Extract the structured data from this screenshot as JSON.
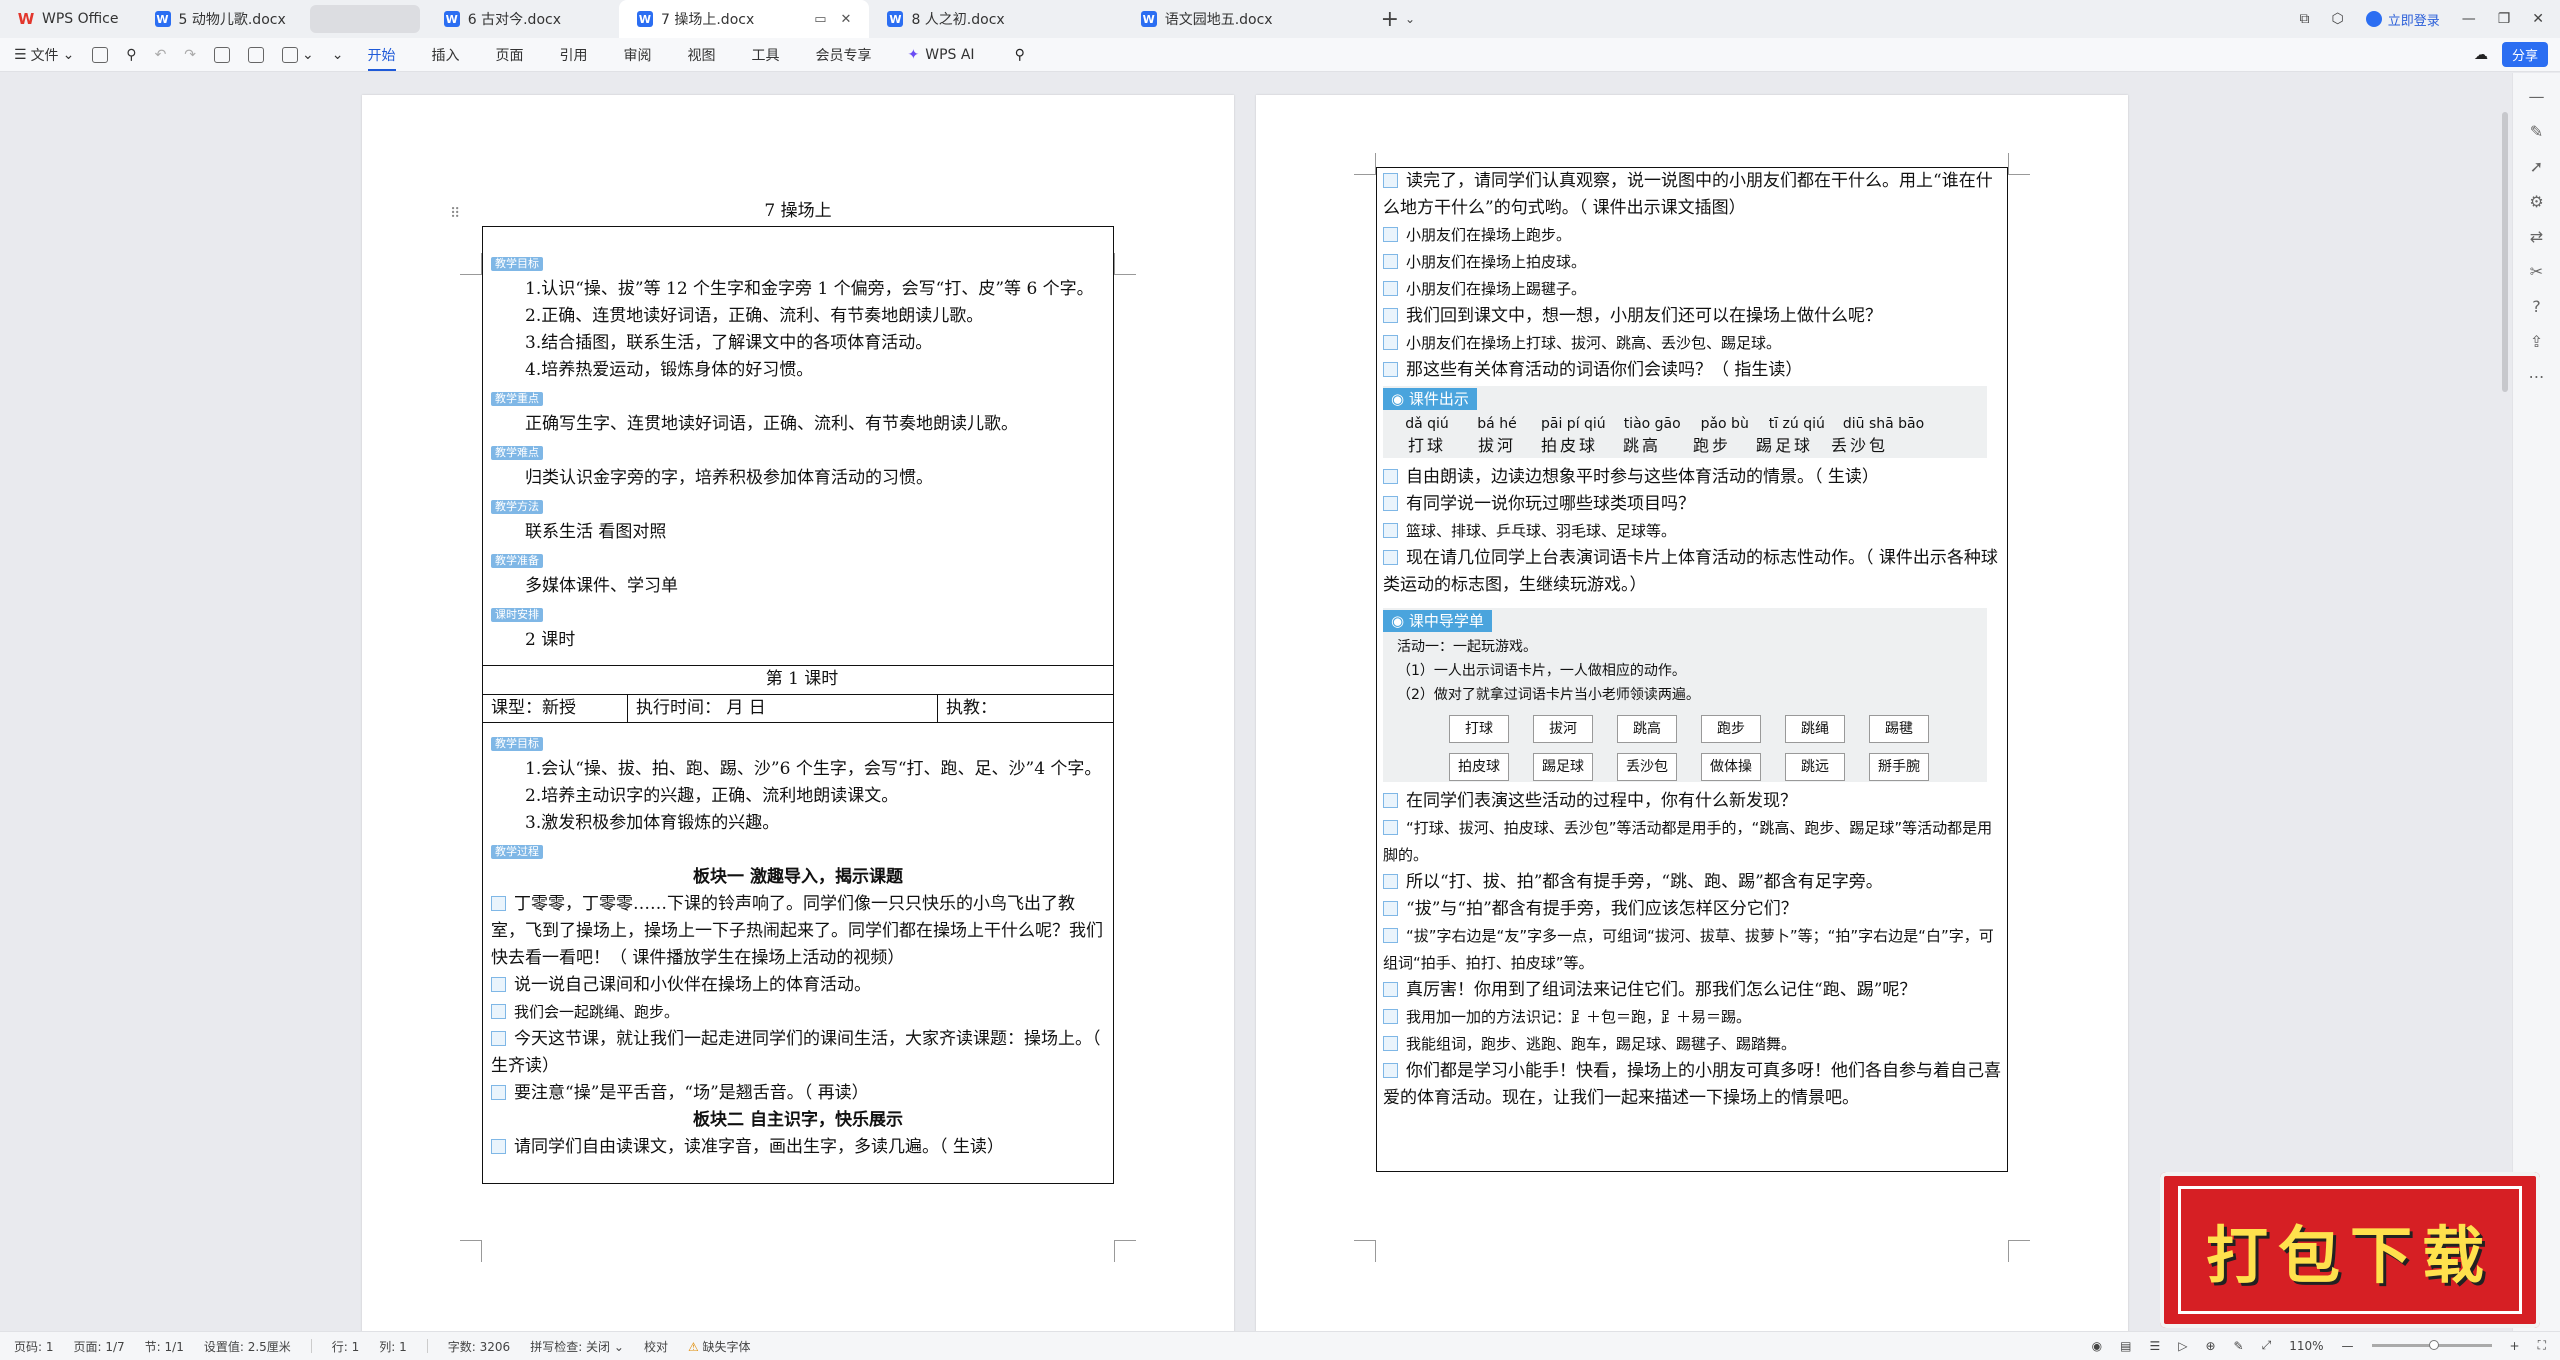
{
  "tabs": [
    {
      "label": "WPS Office",
      "icon": "wps-logo-icon"
    },
    {
      "label": "5 动物儿歌.docx",
      "icon": "doc-icon"
    },
    {
      "label": "",
      "icon": ""
    },
    {
      "label": "6 古对今.docx",
      "icon": "doc-icon"
    },
    {
      "label": "7 操场上.docx",
      "icon": "doc-icon",
      "active": true
    },
    {
      "label": "8 人之初.docx",
      "icon": "doc-icon"
    },
    {
      "label": "语文园地五.docx",
      "icon": "doc-icon"
    }
  ],
  "header": {
    "login_label": "立即登录"
  },
  "ribbon": {
    "file_label": "文件",
    "menus": [
      "开始",
      "插入",
      "页面",
      "引用",
      "审阅",
      "视图",
      "工具",
      "会员专享"
    ],
    "wps_ai": "WPS AI",
    "share_label": "分享"
  },
  "page1": {
    "title": "7  操场上",
    "badges": [
      "教学目标",
      "教学重点",
      "教学难点",
      "教学方法",
      "教学准备",
      "课时安排",
      "教学目标",
      "教学过程"
    ],
    "goals": [
      "1.认识“操、拔”等 12 个生字和金字旁 1 个偏旁，会写“打、皮”等 6 个字。",
      "2.正确、连贯地读好词语，正确、流利、有节奏地朗读儿歌。",
      "3.结合插图，联系生活，了解课文中的各项体育活动。",
      "4.培养热爱运动，锻炼身体的好习惯。"
    ],
    "key_point": "正确写生字、连贯地读好词语，正确、流利、有节奏地朗读儿歌。",
    "difficulty": "归类认识金字旁的字，培养积极参加体育活动的习惯。",
    "method": "联系生活  看图对照",
    "prep": "多媒体课件、学习单",
    "hours": "2 课时",
    "lesson_title": "第 1 课时",
    "row": [
      "课型：新授",
      "执行时间：        月        日",
      "执教："
    ],
    "goals2": [
      "1.会认“操、拔、拍、跑、踢、沙”6 个生字，会写“打、跑、足、沙”4 个字。",
      "2.培养主动识字的兴趣，正确、流利地朗读课文。",
      "3.激发积极参加体育锻炼的兴趣。"
    ],
    "block1": "板块一  激趣导入，揭示课题",
    "paras": [
      "丁零零，丁零零……下课的铃声响了。同学们像一只只快乐的小鸟飞出了教室，飞到了操场上，操场上一下子热闹起来了。同学们都在操场上干什么呢？我们快去看一看吧！（  课件播放学生在操场上活动的视频）",
      "说一说自己课间和小伙伴在操场上的体育活动。",
      "我们会一起跳绳、跑步。",
      "今天这节课，就让我们一起走进同学们的课间生活，大家齐读课题：操场上。（  生齐读）",
      "要注意“操”是平舌音，“场”是翘舌音。（  再读）"
    ],
    "block2": "板块二  自主识字，快乐展示",
    "last": "请同学们自由读课文，读准字音，画出生字，多读几遍。（  生读）"
  },
  "page2": {
    "paras_a": [
      "读完了，请同学们认真观察，说一说图中的小朋友们都在干什么。用上“谁在什么地方干什么”的句式哟。（  课件出示课文插图）",
      "小朋友们在操场上跑步。",
      "小朋友们在操场上拍皮球。",
      "小朋友们在操场上踢毽子。",
      "我们回到课文中，想一想，小朋友们还可以在操场上做什么呢？",
      "小朋友们在操场上打球、拔河、跳高、丢沙包、踢足球。",
      "那这些有关体育活动的词语你们会读吗？（  指生读）"
    ],
    "card1_head": "课件出示",
    "pinyin": [
      "dǎ qiú",
      "bá hé",
      "pāi pí qiú",
      "tiào gāo",
      "pǎo bù",
      "tī zú qiú",
      "diū shā bāo"
    ],
    "words": [
      "打球",
      "拔河",
      "拍皮球",
      "跳高",
      "跑步",
      "踢足球",
      "丢沙包"
    ],
    "paras_b": [
      "自由朗读，边读边想象平时参与这些体育活动的情景。（  生读）",
      "有同学说一说你玩过哪些球类项目吗？",
      "篮球、排球、乒乓球、羽毛球、足球等。",
      "现在请几位同学上台表演词语卡片上体育活动的标志性动作。（  课件出示各种球类运动的标志图，生继续玩游戏。）"
    ],
    "card2_head": "课中导学单",
    "activity": [
      "活动一：一起玩游戏。",
      "（1）一人出示词语卡片，一人做相应的动作。",
      "（2）做对了就拿过词语卡片当小老师领读两遍。"
    ],
    "cards_row1": [
      "打球",
      "拔河",
      "跳高",
      "跑步",
      "跳绳",
      "踢毽"
    ],
    "cards_row2": [
      "拍皮球",
      "踢足球",
      "丢沙包",
      "做体操",
      "跳远",
      "掰手腕"
    ],
    "paras_c": [
      "在同学们表演这些活动的过程中，你有什么新发现？",
      "“打球、拔河、拍皮球、丢沙包”等活动都是用手的，“跳高、跑步、踢足球”等活动都是用脚的。",
      "所以“打、拔、拍”都含有提手旁，“跳、跑、踢”都含有足字旁。",
      "“拔”与“拍”都含有提手旁，我们应该怎样区分它们？",
      "“拔”字右边是“友”字多一点，可组词“拔河、拔草、拔萝卜”等；“拍”字右边是“白”字，可组词“拍手、拍打、拍皮球”等。",
      "真厉害！你用到了组词法来记住它们。那我们怎么记住“跑、踢”呢？",
      "我用加一加的方法识记：⻊＋包＝跑，⻊＋易＝踢。",
      "我能组词，跑步、逃跑、跑车，踢足球、踢毽子、踢踏舞。",
      "你们都是学习小能手！快看，操场上的小朋友可真多呀！他们各自参与着自己喜爱的体育活动。现在，让我们一起来描述一下操场上的情景吧。"
    ]
  },
  "status": {
    "page": "页码: 1",
    "pages": "页面: 1/7",
    "section": "节: 1/1",
    "setting": "设置值: 2.5厘米",
    "line": "行: 1",
    "col": "列: 1",
    "words": "字数: 3206",
    "spell": "拼写检查: 关闭",
    "proof": "校对",
    "font_missing": "缺失字体",
    "zoom": "110%"
  },
  "zoom_level": 1.1,
  "stamp_text": "打包下载",
  "colors": {
    "accent": "#1f5ad8",
    "badge": "#7fb7e6",
    "stamp": "#d61f24",
    "card_head": "#4aa4dd"
  }
}
